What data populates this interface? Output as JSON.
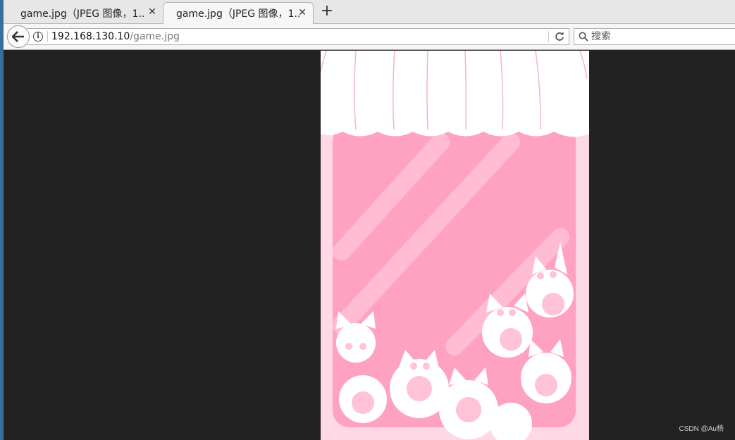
{
  "tabs": [
    {
      "label": "game.jpg（JPEG 图像，1...",
      "close": "✕"
    },
    {
      "label": "game.jpg（JPEG 图像，1...",
      "close": "✕"
    }
  ],
  "new_tab": "+",
  "nav": {
    "url_host": "192.168.130.10",
    "url_path": "/game.jpg",
    "search_placeholder": "搜索",
    "info_symbol": "i"
  },
  "content": {
    "watermark": "CSDN @Au杨"
  },
  "colors": {
    "page_bg": "#222222",
    "image_pink": "#ffa2c1",
    "image_frame": "#ffd8e6"
  },
  "icons": [
    "back-arrow-icon",
    "info-icon",
    "reload-icon",
    "search-icon",
    "close-icon",
    "plus-icon"
  ]
}
